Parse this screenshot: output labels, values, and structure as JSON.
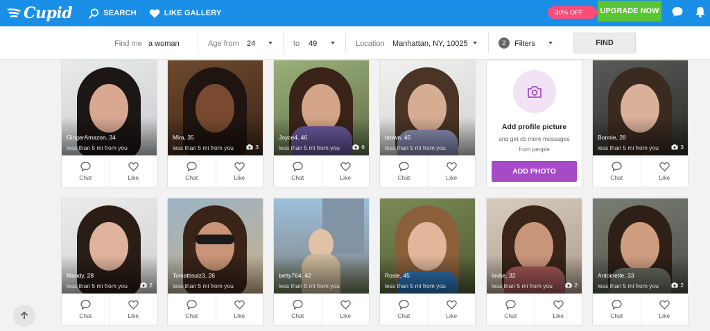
{
  "header": {
    "logo": "Cupid",
    "search_label": "SEARCH",
    "like_gallery_label": "LIKE GALLERY",
    "discount_label": "-30% OFF",
    "upgrade_label": "UPGRADE NOW"
  },
  "filters": {
    "find_me_label": "Find me",
    "find_me_value": "a woman",
    "age_from_label": "Age from",
    "age_from_value": "24",
    "to_label": "to",
    "to_value": "49",
    "location_label": "Location",
    "location_value": "Manhattan, NY, 10025",
    "filters_count": "2",
    "filters_label": "Filters",
    "find_button": "FIND"
  },
  "promo": {
    "title": "Add profile picture",
    "subtitle": "and get x5 more messages from people",
    "button": "ADD PHOTO"
  },
  "card_actions": {
    "chat": "Chat",
    "like": "Like"
  },
  "profiles_row1": [
    {
      "name": "GingerAmazon, 34",
      "distance": "less than 5 mi from you",
      "photos": ""
    },
    {
      "name": "Mira, 35",
      "distance": "less than 5 mi from you",
      "photos": "3"
    },
    {
      "name": "Joyce4, 46",
      "distance": "less than 5 mi from you",
      "photos": "6"
    },
    {
      "name": "brown, 45",
      "distance": "less than 5 mi from you",
      "photos": ""
    },
    {
      "name": "Bonnie, 28",
      "distance": "less than 5 mi from you",
      "photos": "3"
    }
  ],
  "profiles_row2": [
    {
      "name": "Mandy, 28",
      "distance": "less than 5 mi from you",
      "photos": "2"
    },
    {
      "name": "Toniattisulz3, 26",
      "distance": "less than 5 mi from you",
      "photos": ""
    },
    {
      "name": "betty764, 42",
      "distance": "less than 5 mi from you",
      "photos": ""
    },
    {
      "name": "Rosie, 45",
      "distance": "less than 5 mi from you",
      "photos": ""
    },
    {
      "name": "lovbe, 32",
      "distance": "less than 5 mi from you",
      "photos": "2"
    },
    {
      "name": "Antoinette, 33",
      "distance": "less than 5 mi from you",
      "photos": "2"
    }
  ],
  "colors": {
    "header_bg": "#1a8fe8",
    "upgrade": "#59c531",
    "discount": "#fc4a79",
    "promo_accent": "#a64bc8"
  }
}
